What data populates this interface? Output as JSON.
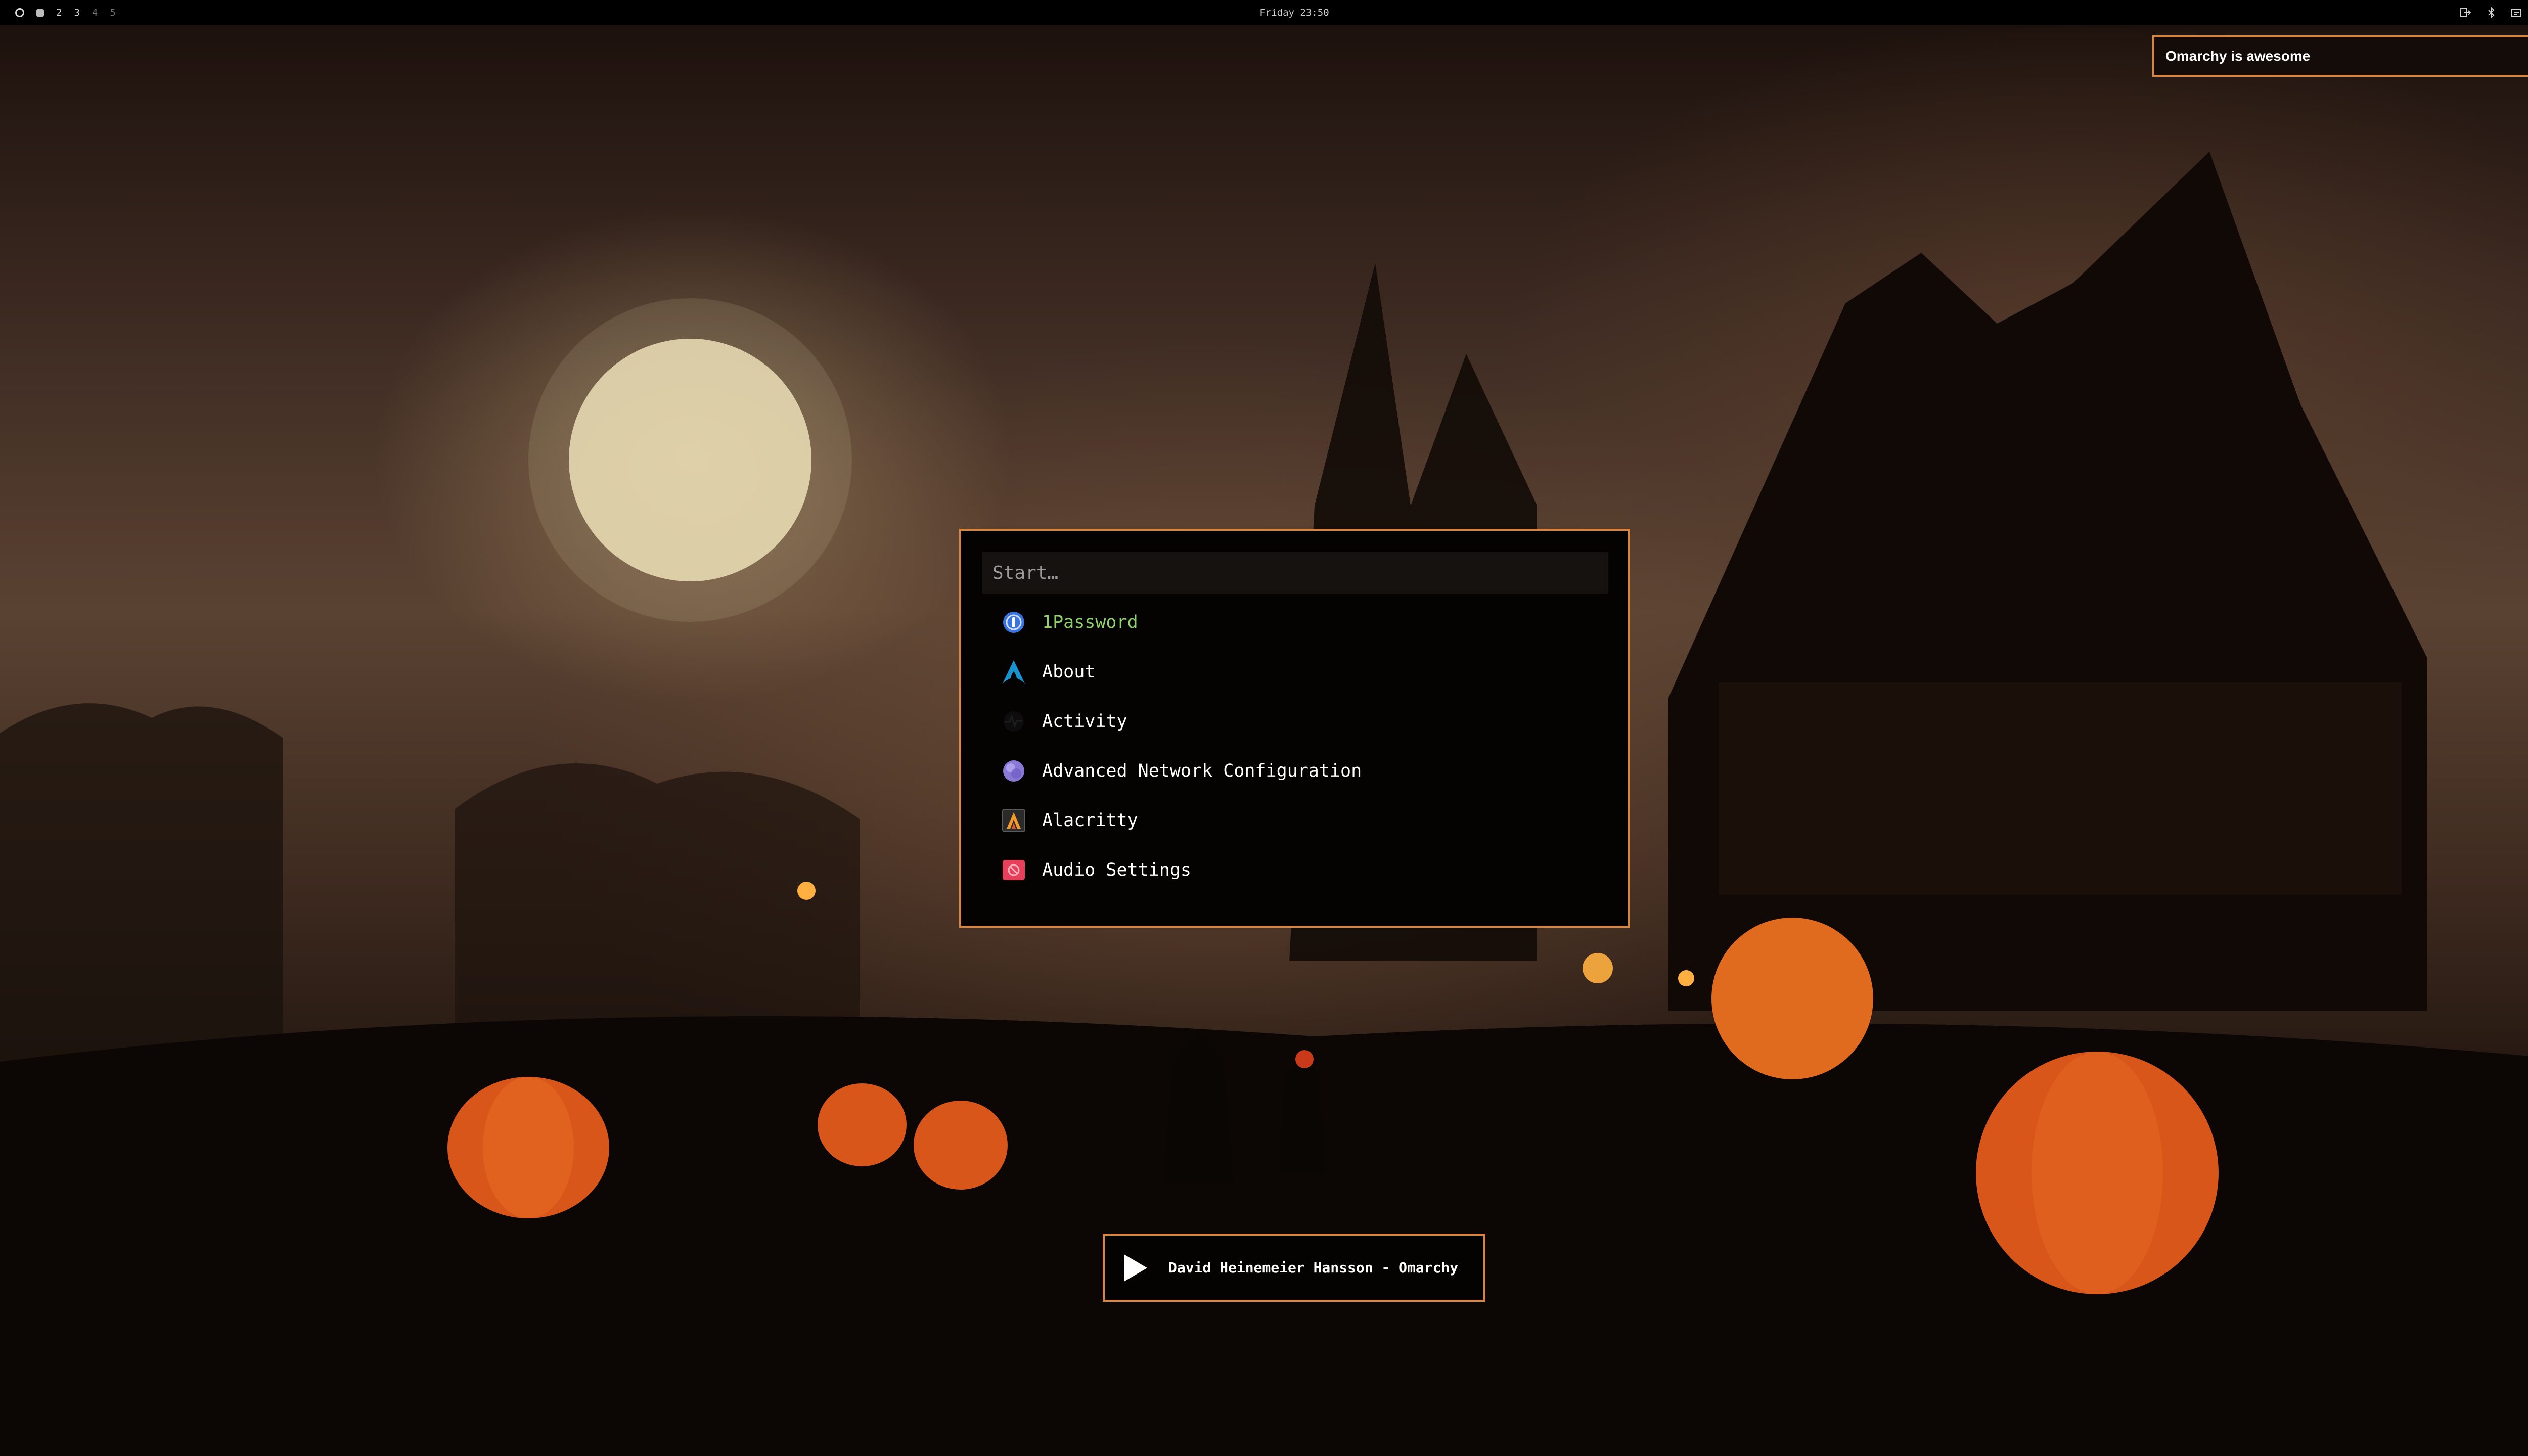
{
  "topbar": {
    "workspaces": [
      {
        "label": "2",
        "dim": false
      },
      {
        "label": "3",
        "dim": false
      },
      {
        "label": "4",
        "dim": true
      },
      {
        "label": "5",
        "dim": true
      }
    ],
    "clock": "Friday 23:50",
    "tray_icons": [
      "share-icon",
      "bluetooth-icon",
      "network-icon",
      "volume-icon",
      "power-icon"
    ]
  },
  "notification": {
    "text": "Omarchy is awesome"
  },
  "launcher": {
    "search_placeholder": "Start…",
    "items": [
      {
        "label": "1Password",
        "icon": "1password-icon"
      },
      {
        "label": "About",
        "icon": "arch-logo-icon"
      },
      {
        "label": "Activity",
        "icon": "activity-icon"
      },
      {
        "label": "Advanced Network Configuration",
        "icon": "network-config-icon"
      },
      {
        "label": "Alacritty",
        "icon": "alacritty-icon"
      },
      {
        "label": "Audio Settings",
        "icon": "audio-settings-icon"
      }
    ],
    "selected_index": 0
  },
  "now_playing": {
    "title": "David Heinemeier Hansson - Omarchy"
  },
  "colors": {
    "accent_border": "#d8863f",
    "selected_text": "#8fd16a",
    "panel_bg": "#050302"
  }
}
